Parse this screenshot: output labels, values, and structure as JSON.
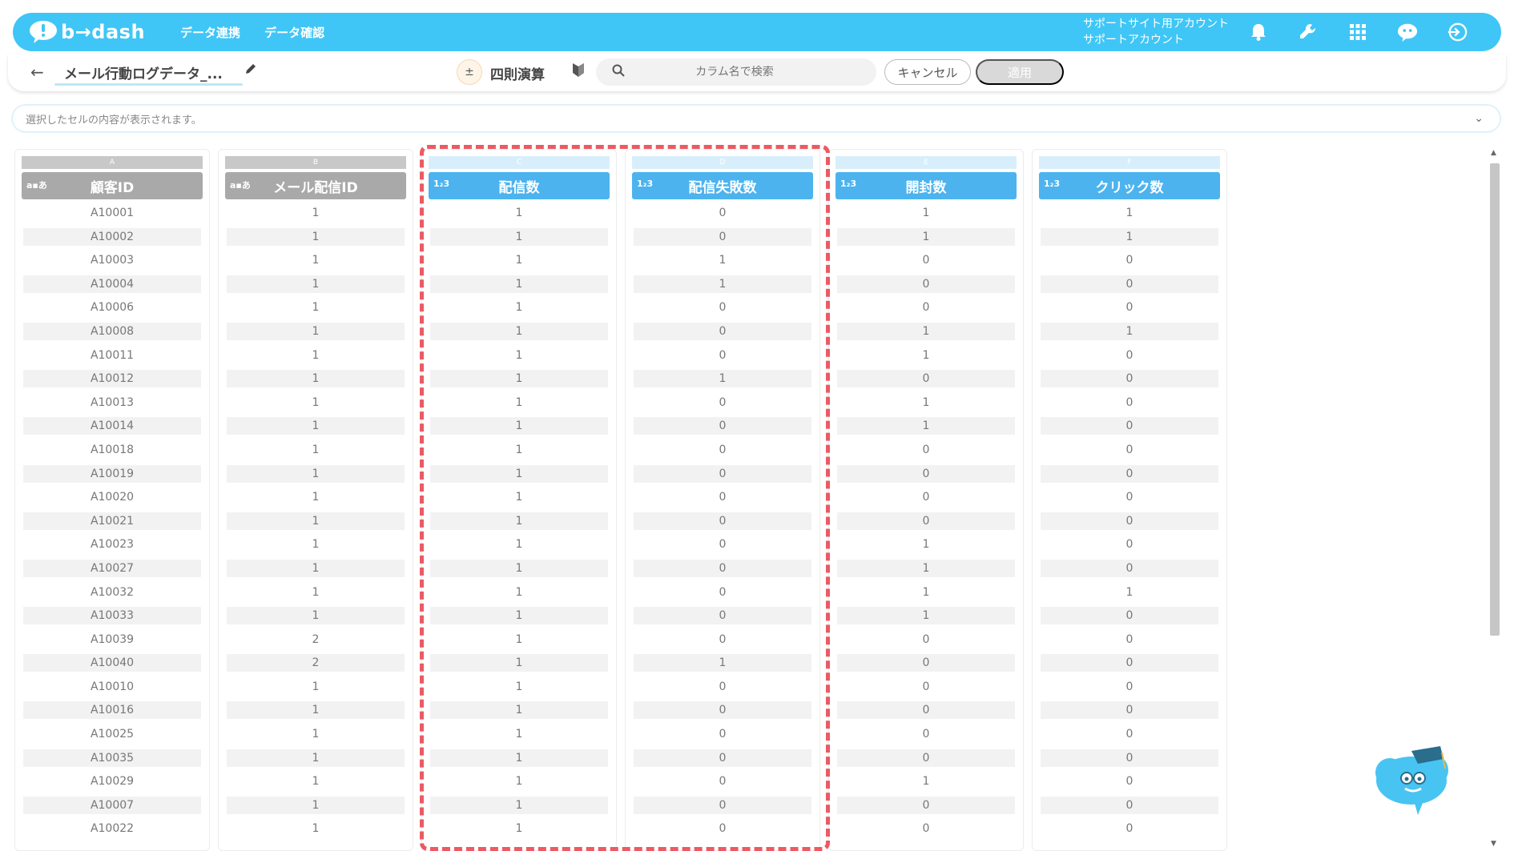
{
  "header": {
    "logo_text": "b→dash",
    "nav": [
      "データ連携",
      "データ確認"
    ],
    "account_line1": "サポートサイト用アカウント",
    "account_line2": "サポートアカウント"
  },
  "toolbar": {
    "back": "←",
    "dataset_title": "メール行動ログデータ_...",
    "operation_label": "四則演算",
    "search_placeholder": "カラム名で検索",
    "cancel_label": "キャンセル",
    "apply_label": "適用"
  },
  "cellbar": {
    "placeholder": "選択したセルの内容が表示されます。"
  },
  "columns": [
    {
      "letter": "A",
      "title": "顧客ID",
      "type": "a▪あ",
      "style": "gray"
    },
    {
      "letter": "B",
      "title": "メール配信ID",
      "type": "a▪あ",
      "style": "gray"
    },
    {
      "letter": "C",
      "title": "配信数",
      "type": "1₂3",
      "style": "blue"
    },
    {
      "letter": "D",
      "title": "配信失敗数",
      "type": "1₂3",
      "style": "blue"
    },
    {
      "letter": "E",
      "title": "開封数",
      "type": "1₂3",
      "style": "blue"
    },
    {
      "letter": "F",
      "title": "クリック数",
      "type": "1₂3",
      "style": "blue"
    }
  ],
  "rows": [
    [
      "A10001",
      "1",
      "1",
      "0",
      "1",
      "1"
    ],
    [
      "A10002",
      "1",
      "1",
      "0",
      "1",
      "1"
    ],
    [
      "A10003",
      "1",
      "1",
      "1",
      "0",
      "0"
    ],
    [
      "A10004",
      "1",
      "1",
      "1",
      "0",
      "0"
    ],
    [
      "A10006",
      "1",
      "1",
      "0",
      "0",
      "0"
    ],
    [
      "A10008",
      "1",
      "1",
      "0",
      "1",
      "1"
    ],
    [
      "A10011",
      "1",
      "1",
      "0",
      "1",
      "0"
    ],
    [
      "A10012",
      "1",
      "1",
      "1",
      "0",
      "0"
    ],
    [
      "A10013",
      "1",
      "1",
      "0",
      "1",
      "0"
    ],
    [
      "A10014",
      "1",
      "1",
      "0",
      "1",
      "0"
    ],
    [
      "A10018",
      "1",
      "1",
      "0",
      "0",
      "0"
    ],
    [
      "A10019",
      "1",
      "1",
      "0",
      "0",
      "0"
    ],
    [
      "A10020",
      "1",
      "1",
      "0",
      "0",
      "0"
    ],
    [
      "A10021",
      "1",
      "1",
      "0",
      "0",
      "0"
    ],
    [
      "A10023",
      "1",
      "1",
      "0",
      "1",
      "0"
    ],
    [
      "A10027",
      "1",
      "1",
      "0",
      "1",
      "0"
    ],
    [
      "A10032",
      "1",
      "1",
      "0",
      "1",
      "1"
    ],
    [
      "A10033",
      "1",
      "1",
      "0",
      "1",
      "0"
    ],
    [
      "A10039",
      "2",
      "1",
      "0",
      "0",
      "0"
    ],
    [
      "A10040",
      "2",
      "1",
      "1",
      "0",
      "0"
    ],
    [
      "A10010",
      "1",
      "1",
      "0",
      "0",
      "0"
    ],
    [
      "A10016",
      "1",
      "1",
      "0",
      "0",
      "0"
    ],
    [
      "A10025",
      "1",
      "1",
      "0",
      "0",
      "0"
    ],
    [
      "A10035",
      "1",
      "1",
      "0",
      "0",
      "0"
    ],
    [
      "A10029",
      "1",
      "1",
      "0",
      "1",
      "0"
    ],
    [
      "A10007",
      "1",
      "1",
      "0",
      "0",
      "0"
    ],
    [
      "A10022",
      "1",
      "1",
      "0",
      "0",
      "0"
    ]
  ],
  "colors": {
    "header_bg": "#3fc6f6",
    "numeric_header": "#4cb3ef",
    "text_header": "#a9a9a9",
    "highlight_dash": "#ec5a63"
  }
}
